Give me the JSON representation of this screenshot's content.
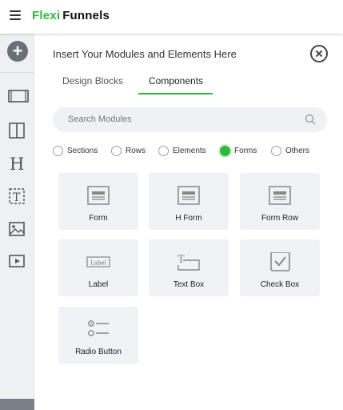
{
  "app": {
    "logo_part1": "Flexi",
    "logo_part2": "Funnels"
  },
  "panel": {
    "title": "Insert Your Modules and Elements Here",
    "tabs": [
      {
        "label": "Design Blocks",
        "active": false
      },
      {
        "label": "Components",
        "active": true
      }
    ],
    "search": {
      "placeholder": "Search Modules"
    },
    "filters": [
      {
        "label": "Sections",
        "selected": false
      },
      {
        "label": "Rows",
        "selected": false
      },
      {
        "label": "Elements",
        "selected": false
      },
      {
        "label": "Forms",
        "selected": true
      },
      {
        "label": "Others",
        "selected": false
      }
    ],
    "components": [
      {
        "label": "Form",
        "icon": "form-icon"
      },
      {
        "label": "H Form",
        "icon": "form-icon"
      },
      {
        "label": "Form Row",
        "icon": "form-icon"
      },
      {
        "label": "Label",
        "icon": "label-icon"
      },
      {
        "label": "Text Box",
        "icon": "text-box-icon"
      },
      {
        "label": "Check Box",
        "icon": "check-box-icon"
      },
      {
        "label": "Radio Button",
        "icon": "radio-button-icon"
      }
    ]
  },
  "sidebar": {
    "items": [
      "add-icon",
      "section-icon",
      "columns-icon",
      "heading-icon",
      "text-icon",
      "image-icon",
      "video-icon"
    ]
  },
  "colors": {
    "accent": "#2dba3b",
    "card_bg": "#f1f2f6",
    "rail_bg": "#eef0f4"
  }
}
